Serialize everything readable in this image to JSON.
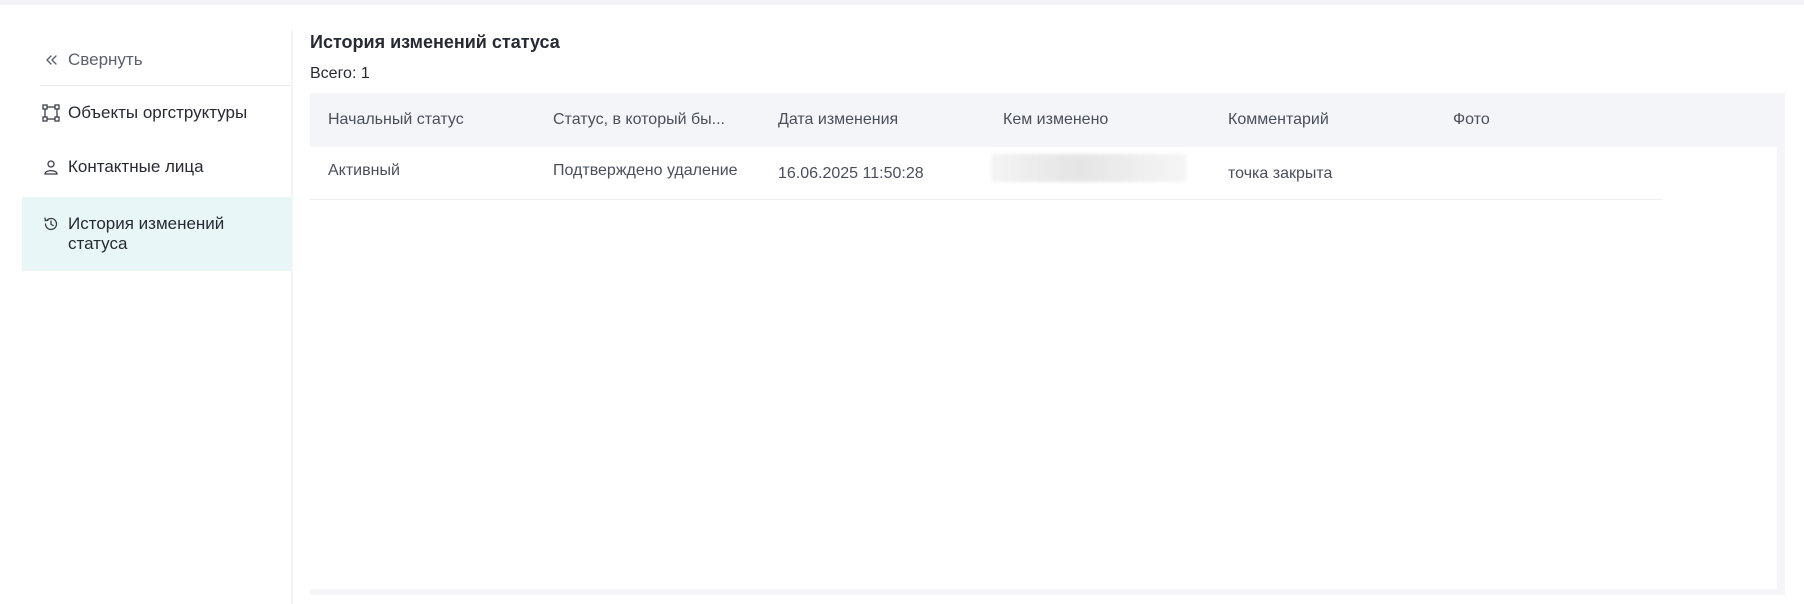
{
  "sidebar": {
    "collapse_label": "Свернуть",
    "items": [
      {
        "label": "Объекты оргструктуры",
        "icon": "org-structure-icon"
      },
      {
        "label": "Контактные лица",
        "icon": "person-icon"
      },
      {
        "label": "История изменений статуса",
        "icon": "history-icon",
        "active": true
      }
    ]
  },
  "main": {
    "title": "История изменений статуса",
    "total": "Всего: 1"
  },
  "table": {
    "columns": [
      "Начальный статус",
      "Статус, в который бы...",
      "Дата изменения",
      "Кем изменено",
      "Комментарий",
      "Фото"
    ],
    "rows": [
      {
        "initial_status": "Активный",
        "new_status": "Подтверждено удаление",
        "date": "16.06.2025 11:50:28",
        "changed_by": "",
        "comment": "точка закрыта",
        "photo": ""
      }
    ]
  },
  "colors": {
    "active_bg": "#e8f6f8",
    "header_bg": "#f4f5f8",
    "text": "#262a33",
    "muted": "#4a4f5c"
  }
}
